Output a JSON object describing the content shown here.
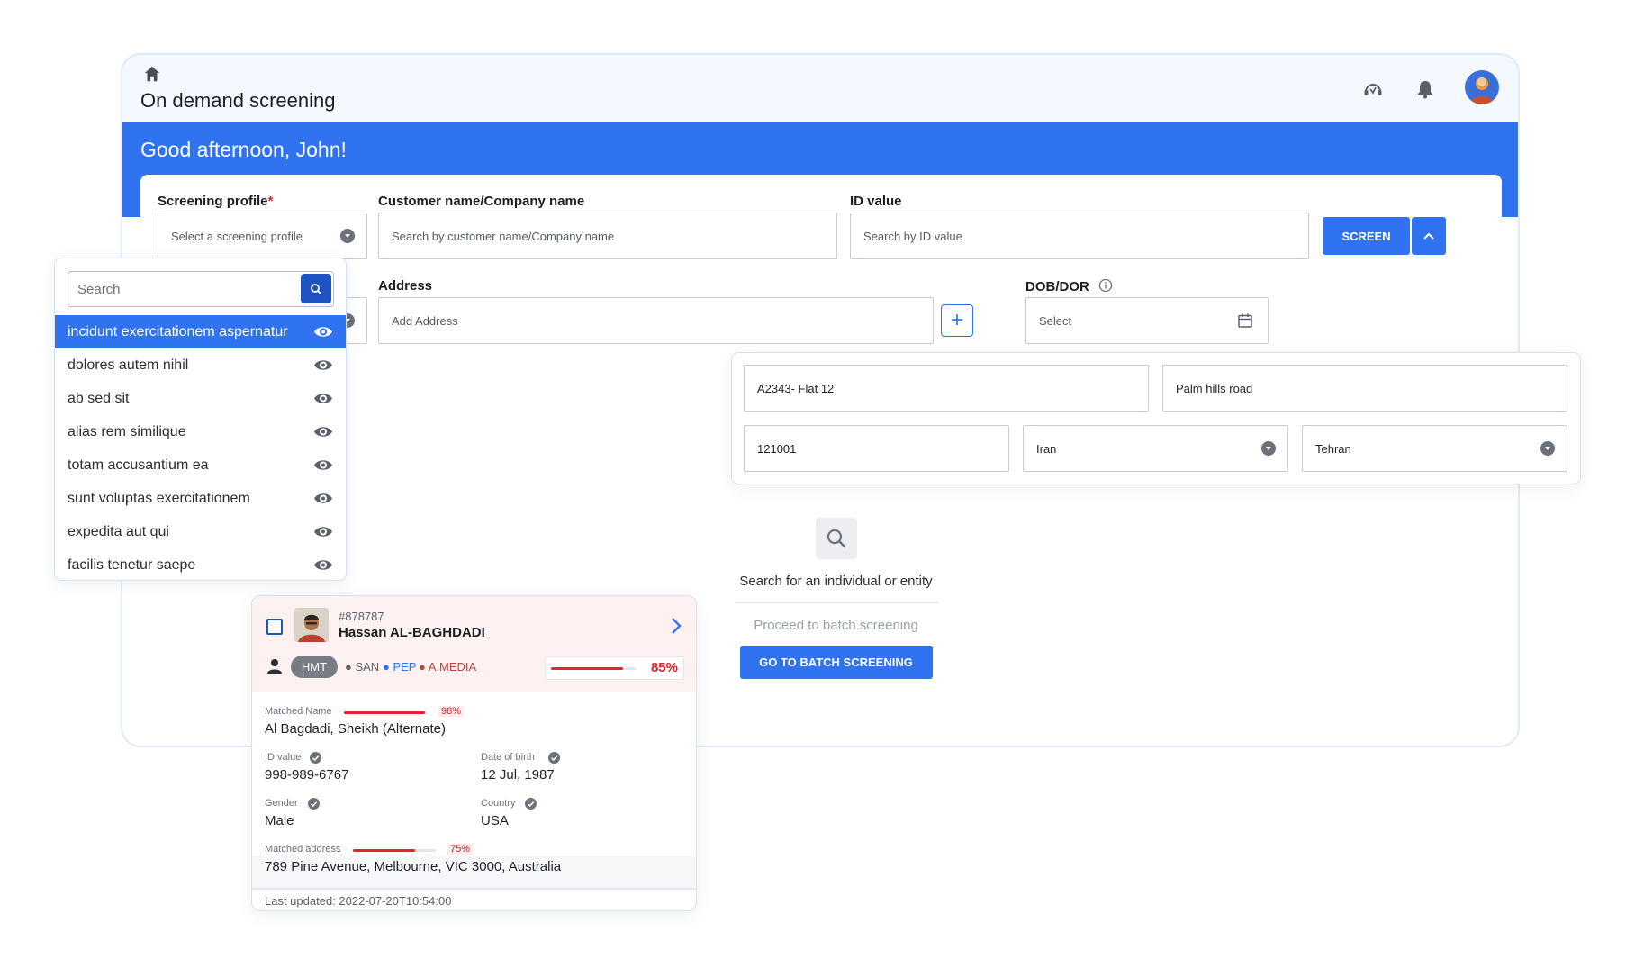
{
  "header": {
    "page_title": "On demand screening",
    "greeting": "Good afternoon, John!"
  },
  "form": {
    "screening_profile_label": "Screening profile",
    "required_mark": "*",
    "screening_profile_placeholder": "Select a screening profile",
    "customer_label": "Customer name/Company name",
    "customer_placeholder": "Search by customer name/Company name",
    "id_label": "ID value",
    "id_placeholder": "Search by ID value",
    "screen_button": "SCREEN",
    "address_label": "Address",
    "address_placeholder": "Add Address",
    "dob_label": "DOB/DOR",
    "dob_placeholder": "Select"
  },
  "profile_dropdown": {
    "search_placeholder": "Search",
    "items": [
      {
        "label": "incidunt exercitationem aspernatur",
        "selected": true
      },
      {
        "label": "dolores autem nihil",
        "selected": false
      },
      {
        "label": "ab sed sit",
        "selected": false
      },
      {
        "label": "alias rem similique",
        "selected": false
      },
      {
        "label": "totam accusantium ea",
        "selected": false
      },
      {
        "label": "sunt voluptas exercitationem",
        "selected": false
      },
      {
        "label": "expedita aut qui",
        "selected": false
      },
      {
        "label": "facilis tenetur saepe",
        "selected": false
      }
    ]
  },
  "address_popup": {
    "line1": "A2343- Flat 12",
    "line2": "Palm hills road",
    "postcode": "121001",
    "country": "Iran",
    "city": "Tehran"
  },
  "empty_state": {
    "message": "Search for an individual or entity",
    "batch_text": "Proceed to batch screening",
    "batch_button": "GO TO BATCH SCREENING"
  },
  "result_card": {
    "record_id": "#878787",
    "name": "Hassan AL-BAGHDADI",
    "tag": "HMT",
    "flags": [
      {
        "label": "SAN",
        "color": "#5c616b"
      },
      {
        "label": "PEP",
        "color": "#2f73f0"
      },
      {
        "label": "A.MEDIA",
        "color": "#b04a3a"
      }
    ],
    "overall_score": "85%",
    "overall_score_value": 0.85,
    "matched_name_label": "Matched Name",
    "matched_name_score": "98%",
    "matched_name_value": 0.98,
    "matched_name": "Al Bagdadi, Sheikh (Alternate)",
    "id_label": "ID value",
    "id_value": "998-989-6767",
    "dob_label": "Date of birth",
    "dob_value": "12 Jul, 1987",
    "gender_label": "Gender",
    "gender_value": "Male",
    "country_label": "Country",
    "country_value": "USA",
    "address_label": "Matched address",
    "address_score": "75%",
    "address_score_value": 0.75,
    "address_value": "789 Pine Avenue, Melbourne, VIC 3000, Australia",
    "last_updated": "Last updated: 2022-07-20T10:54:00"
  },
  "colors": {
    "primary": "#2f73f0",
    "danger": "#e0252b",
    "header_bg": "#f4f8ff"
  },
  "icons": [
    "home-icon",
    "support-icon",
    "bell-icon",
    "search-icon",
    "eye-icon",
    "calendar-icon",
    "chevron-up-icon",
    "chevron-right-icon",
    "check-icon",
    "person-icon",
    "info-icon"
  ]
}
